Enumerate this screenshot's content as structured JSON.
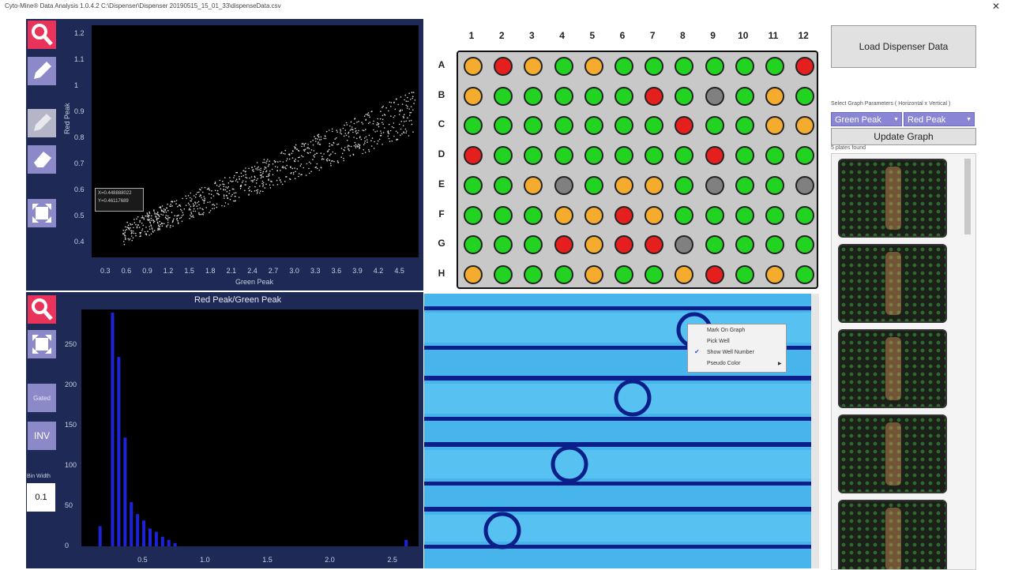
{
  "window": {
    "title": "Cyto-Mine® Data Analysis 1.0.4.2 C:\\Dispenser\\Dispenser 20190515_15_01_33\\dispenseData.csv"
  },
  "scatter": {
    "x_ticks": [
      "0.3",
      "0.6",
      "0.9",
      "1.2",
      "1.5",
      "1.8",
      "2.1",
      "2.4",
      "2.7",
      "3.0",
      "3.3",
      "3.6",
      "3.9",
      "4.2",
      "4.5"
    ],
    "y_ticks": [
      "1.2",
      "1.1",
      "1",
      "0.9",
      "0.8",
      "0.7",
      "0.6",
      "0.5",
      "0.4"
    ],
    "xlabel": "Green Peak",
    "ylabel": "Red Peak",
    "tooltip_line1": "X=0.448888022",
    "tooltip_line2": "Y=0.46117689"
  },
  "histogram": {
    "title": "Red Peak/Green Peak",
    "x_ticks": [
      "0.5",
      "1.0",
      "1.5",
      "2.0",
      "2.5"
    ],
    "y_ticks": [
      "250",
      "200",
      "150",
      "100",
      "50",
      "0"
    ],
    "bin_width_label": "Bin Width",
    "bin_width_value": "0.1",
    "inv_label": "INV",
    "gated_label": "Gated"
  },
  "chart_data": {
    "type": "bar",
    "title": "Red Peak/Green Peak",
    "x": [
      0.15,
      0.25,
      0.3,
      0.35,
      0.4,
      0.45,
      0.5,
      0.55,
      0.6,
      0.65,
      0.7,
      0.75,
      2.6
    ],
    "values": [
      25,
      290,
      235,
      135,
      55,
      40,
      32,
      22,
      18,
      12,
      8,
      4,
      8
    ],
    "ylim": [
      0,
      290
    ],
    "xlim": [
      0,
      2.7
    ]
  },
  "plate": {
    "columns": [
      "1",
      "2",
      "3",
      "4",
      "5",
      "6",
      "7",
      "8",
      "9",
      "10",
      "11",
      "12"
    ],
    "rows": [
      "A",
      "B",
      "C",
      "D",
      "E",
      "F",
      "G",
      "H"
    ],
    "well_codes": [
      "OROGOGGGGGGR",
      "OGGGGGRGYGOG",
      "GGGGGGGRGGOO",
      "RGGGGGGGRGGG",
      "GGOYGOOGYGGY",
      "GGGOOROGGGGG",
      "GGGRORRYGGGG",
      "OGGGOGGORGOG"
    ],
    "colors": {
      "G": "#22d322",
      "O": "#f4ab2e",
      "R": "#e51e1e",
      "Y": "#808080"
    }
  },
  "context_menu": {
    "items": [
      "Mark On Graph",
      "Pick Well",
      "Show Well Number",
      "Pseudo Color"
    ]
  },
  "right": {
    "load_button": "Load Dispenser Data",
    "params_label": "Select Graph Parameters ( Horizontal x Vertical )",
    "x_param": "Green Peak",
    "y_param": "Red Peak",
    "update_button": "Update Graph",
    "plates_found": "5 plates found"
  },
  "theme": {
    "toolbar_bg": "#1e2a55",
    "accent": "#8a86d6",
    "bar_color": "#1e22d8"
  }
}
